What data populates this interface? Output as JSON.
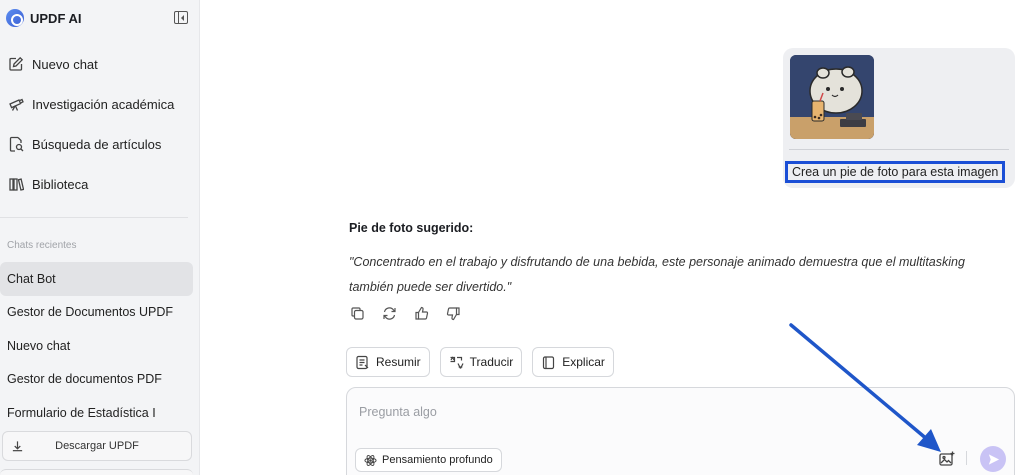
{
  "app": {
    "name": "UPDF AI"
  },
  "sidebar": {
    "nav": [
      {
        "label": "Nuevo chat",
        "icon": "edit-icon"
      },
      {
        "label": "Investigación académica",
        "icon": "telescope-icon"
      },
      {
        "label": "Búsqueda de artículos",
        "icon": "search-document-icon"
      },
      {
        "label": "Biblioteca",
        "icon": "library-icon"
      }
    ],
    "recent_title": "Chats recientes",
    "recent": [
      {
        "label": "Chat Bot",
        "active": true
      },
      {
        "label": "Gestor de Documentos UPDF"
      },
      {
        "label": "Nuevo chat"
      },
      {
        "label": "Gestor de documentos PDF"
      },
      {
        "label": "Formulario de Estadística I"
      }
    ],
    "download_label": "Descargar UPDF"
  },
  "chat": {
    "user_message": "Crea un pie de foto para esta imagen",
    "reply_title": "Pie de foto sugerido:",
    "reply_body": "\"Concentrado en el trabajo y disfrutando de una bebida, este personaje animado demuestra que el multitasking también puede ser divertido.\"",
    "actions": [
      "copy-icon",
      "regenerate-icon",
      "thumbs-up-icon",
      "thumbs-down-icon"
    ]
  },
  "quick_actions": [
    {
      "label": "Resumir",
      "icon": "summary-icon"
    },
    {
      "label": "Traducir",
      "icon": "translate-icon"
    },
    {
      "label": "Explicar",
      "icon": "explain-icon"
    }
  ],
  "composer": {
    "placeholder": "Pregunta algo",
    "deep_thinking_label": "Pensamiento profundo"
  },
  "colors": {
    "highlight_box": "#1b4fd6",
    "annotation_arrow": "#1f56c9",
    "send_button": "#c9c3f5"
  }
}
